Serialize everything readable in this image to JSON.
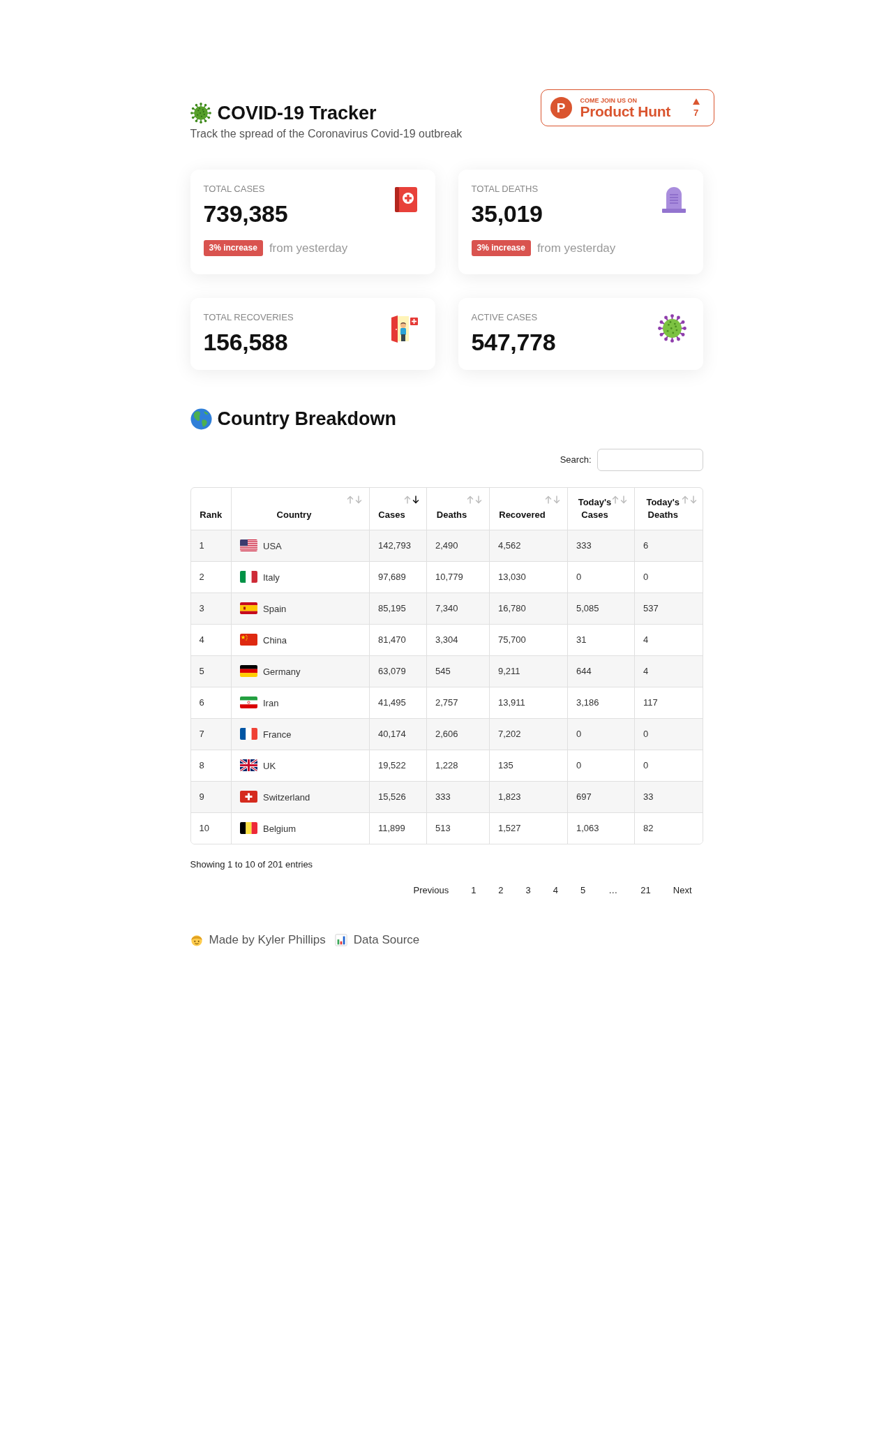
{
  "header": {
    "title": "COVID-19 Tracker",
    "subtitle": "Track the spread of the Coronavirus Covid-19 outbreak"
  },
  "product_hunt_badge": {
    "logo_letter": "P",
    "kicker": "COME JOIN US ON",
    "name": "Product Hunt",
    "votes": "7"
  },
  "stat_cards": [
    {
      "label": "TOTAL CASES",
      "value": "739,385",
      "change": {
        "badge": "3% increase",
        "text": "from yesterday"
      }
    },
    {
      "label": "TOTAL DEATHS",
      "value": "35,019",
      "change": {
        "badge": "3% increase",
        "text": "from yesterday"
      }
    },
    {
      "label": "TOTAL RECOVERIES",
      "value": "156,588"
    },
    {
      "label": "ACTIVE CASES",
      "value": "547,778"
    }
  ],
  "country_breakdown": {
    "title": "Country Breakdown",
    "search": {
      "label": "Search:"
    },
    "table": {
      "columns": [
        {
          "label": "Rank"
        },
        {
          "label": "Country",
          "sorted_descending": false
        },
        {
          "label": "Cases",
          "sorted_descending": true
        },
        {
          "label": "Deaths",
          "sorted_descending": false
        },
        {
          "label": "Recovered",
          "sorted_descending": false
        },
        {
          "label": "Today's Cases",
          "sorted_descending": false
        },
        {
          "label": "Today's Deaths",
          "sorted_descending": false
        }
      ],
      "rows": [
        [
          "1",
          "USA",
          "142,793",
          "2,490",
          "4,562",
          "333",
          "6"
        ],
        [
          "2",
          "Italy",
          "97,689",
          "10,779",
          "13,030",
          "0",
          "0"
        ],
        [
          "3",
          "Spain",
          "85,195",
          "7,340",
          "16,780",
          "5,085",
          "537"
        ],
        [
          "4",
          "China",
          "81,470",
          "3,304",
          "75,700",
          "31",
          "4"
        ],
        [
          "5",
          "Germany",
          "63,079",
          "545",
          "9,211",
          "644",
          "4"
        ],
        [
          "6",
          "Iran",
          "41,495",
          "2,757",
          "13,911",
          "3,186",
          "117"
        ],
        [
          "7",
          "France",
          "40,174",
          "2,606",
          "7,202",
          "0",
          "0"
        ],
        [
          "8",
          "UK",
          "19,522",
          "1,228",
          "135",
          "0",
          "0"
        ],
        [
          "9",
          "Switzerland",
          "15,526",
          "333",
          "1,823",
          "697",
          "33"
        ],
        [
          "10",
          "Belgium",
          "11,899",
          "513",
          "1,527",
          "1,063",
          "82"
        ]
      ]
    },
    "info": "Showing 1 to 10 of 201 entries",
    "pagination": [
      {
        "label": "Previous",
        "kind": "prev"
      },
      {
        "label": "1",
        "kind": "page"
      },
      {
        "label": "2",
        "kind": "page"
      },
      {
        "label": "3",
        "kind": "page"
      },
      {
        "label": "4",
        "kind": "page"
      },
      {
        "label": "5",
        "kind": "page"
      },
      {
        "label": "…",
        "kind": "gap"
      },
      {
        "label": "21",
        "kind": "page"
      },
      {
        "label": "Next",
        "kind": "next"
      }
    ]
  },
  "footer": {
    "links": [
      "Made by Kyler Phillips",
      "Data Source"
    ]
  }
}
